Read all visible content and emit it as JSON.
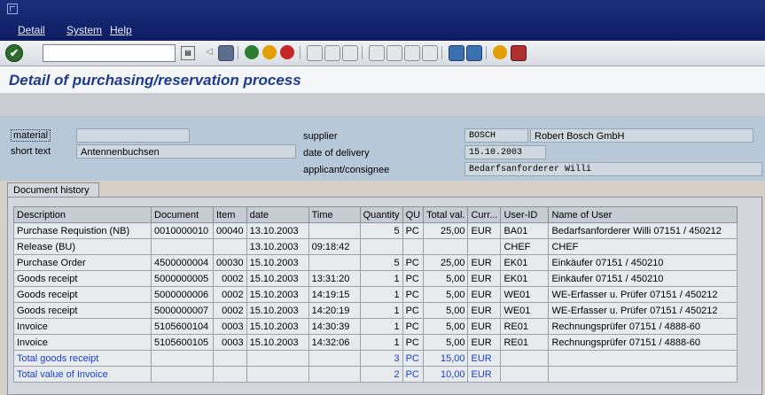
{
  "menu": [
    "Detail",
    "System",
    "Help"
  ],
  "toolbar": {
    "command_value": "",
    "ok_icon": "enter-check-icon"
  },
  "title": "Detail of purchasing/reservation process",
  "header": {
    "material_label": "material",
    "material_value": "",
    "shorttext_label": "short text",
    "shorttext_value": "Antennenbuchsen",
    "supplier_label": "supplier",
    "supplier_code": "BOSCH",
    "supplier_name": "Robert Bosch GmbH",
    "delivery_label": "date of delivery",
    "delivery_value": "15.10.2003",
    "applicant_label": "applicant/consignee",
    "applicant_value": "Bedarfsanforderer Willi"
  },
  "tab_label": "Document history",
  "table": {
    "columns": [
      "Description",
      "Document",
      "Item",
      "date",
      "Time",
      "Quantity",
      "QU",
      "Total val.",
      "Curr...",
      "User-ID",
      "Name of User"
    ],
    "rows": [
      [
        "Purchase Requistion (NB)",
        "0010000010",
        "00040",
        "13.10.2003",
        "",
        "5",
        "PC",
        "25,00",
        "EUR",
        "BA01",
        "Bedarfsanforderer Willi 07151 / 450212"
      ],
      [
        "Release (BU)",
        "",
        "",
        "13.10.2003",
        "09:18:42",
        "",
        "",
        "",
        "",
        "CHEF",
        "CHEF"
      ],
      [
        "Purchase Order",
        "4500000004",
        "00030",
        "15.10.2003",
        "",
        "5",
        "PC",
        "25,00",
        "EUR",
        "EK01",
        "Einkäufer 07151 / 450210"
      ],
      [
        "Goods receipt",
        "5000000005",
        "0002",
        "15.10.2003",
        "13:31:20",
        "1",
        "PC",
        "5,00",
        "EUR",
        "EK01",
        "Einkäufer 07151 / 450210"
      ],
      [
        "Goods receipt",
        "5000000006",
        "0002",
        "15.10.2003",
        "14:19:15",
        "1",
        "PC",
        "5,00",
        "EUR",
        "WE01",
        "WE-Erfasser u. Prüfer 07151 / 450212"
      ],
      [
        "Goods receipt",
        "5000000007",
        "0002",
        "15.10.2003",
        "14:20:19",
        "1",
        "PC",
        "5,00",
        "EUR",
        "WE01",
        "WE-Erfasser u. Prüfer 07151 / 450212"
      ],
      [
        "Invoice",
        "5105600104",
        "0003",
        "15.10.2003",
        "14:30:39",
        "1",
        "PC",
        "5,00",
        "EUR",
        "RE01",
        "Rechnungsprüfer 07151 / 4888-60"
      ],
      [
        "Invoice",
        "5105600105",
        "0003",
        "15.10.2003",
        "14:32:06",
        "1",
        "PC",
        "5,00",
        "EUR",
        "RE01",
        "Rechnungsprüfer 07151 / 4888-60"
      ]
    ],
    "totals": [
      [
        "Total goods receipt",
        "",
        "",
        "",
        "",
        "3",
        "PC",
        "15,00",
        "EUR",
        "",
        ""
      ],
      [
        "Total value of Invoice",
        "",
        "",
        "",
        "",
        "2",
        "PC",
        "10,00",
        "EUR",
        "",
        ""
      ]
    ]
  },
  "colors": {
    "title": "#1e3a8a",
    "total_text": "#1a40c8",
    "header_bg": "#b7c8d8"
  }
}
